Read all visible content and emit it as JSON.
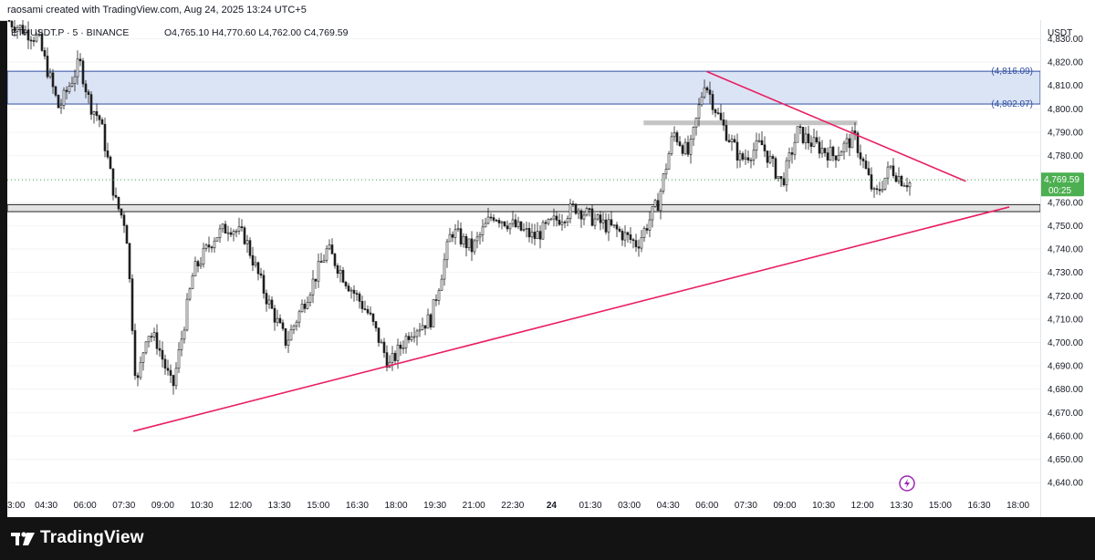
{
  "header": {
    "credit": "raosami created with TradingView.com, Aug 24, 2025 13:24 UTC+5"
  },
  "symbol_info": {
    "symbol": "ETHUSDT.P",
    "interval": "5",
    "exchange": "BINANCE",
    "ohlc": "O4,765.10  H4,770.60  L4,762.00  C4,769.59"
  },
  "price_axis": {
    "currency": "USDT",
    "ticks": [
      "4,830.00",
      "4,820.00",
      "4,810.00",
      "4,800.00",
      "4,790.00",
      "4,780.00",
      "4,770.00",
      "4,760.00",
      "4,750.00",
      "4,740.00",
      "4,730.00",
      "4,720.00",
      "4,710.00",
      "4,700.00",
      "4,690.00",
      "4,680.00",
      "4,670.00",
      "4,660.00",
      "4,650.00",
      "4,640.00"
    ],
    "last_price_label": "4,769.59",
    "countdown": "00:25"
  },
  "time_axis": {
    "ticks": [
      "3:00",
      "04:30",
      "06:00",
      "07:30",
      "09:00",
      "10:30",
      "12:00",
      "13:30",
      "15:00",
      "16:30",
      "18:00",
      "19:30",
      "21:00",
      "22:30",
      "24",
      "01:30",
      "03:00",
      "04:30",
      "06:00",
      "07:30",
      "09:00",
      "10:30",
      "12:00",
      "13:30",
      "15:00",
      "16:30",
      "18:00"
    ]
  },
  "annotations": {
    "zone_top_label": "(4,816.09)",
    "zone_bottom_label": "(4,802.07)"
  },
  "footer": {
    "brand": "TradingView"
  },
  "colors": {
    "up": "#26a69a",
    "down": "#ef5350",
    "candle_body": "#1e1e1e",
    "trendline": "#e91e63",
    "zone_fill": "#dbe4f5",
    "zone_border": "#2f4fa0",
    "support_band": "#e3e3e3",
    "last_price": "#4caf50"
  },
  "chart_data": {
    "type": "candlestick",
    "symbol": "ETHUSDT.P",
    "timeframe": "5",
    "ylim": [
      4635,
      4838
    ],
    "last_price": 4769.59,
    "resistance_zone": [
      4802.07,
      4816.09
    ],
    "support_band": [
      4756,
      4759
    ],
    "mini_resistance_band": [
      4793,
      4795
    ],
    "trendlines": [
      {
        "name": "ascending",
        "points": [
          [
            0.122,
            4662
          ],
          [
            0.97,
            4758
          ]
        ]
      },
      {
        "name": "descending",
        "points": [
          [
            0.677,
            4816
          ],
          [
            0.928,
            4769
          ]
        ]
      }
    ],
    "price_path_hours": [
      [
        0.0,
        4838
      ],
      [
        0.03,
        4830
      ],
      [
        0.05,
        4800
      ],
      [
        0.07,
        4820
      ],
      [
        0.08,
        4802
      ],
      [
        0.09,
        4795
      ],
      [
        0.105,
        4760
      ],
      [
        0.115,
        4750
      ],
      [
        0.125,
        4680
      ],
      [
        0.135,
        4705
      ],
      [
        0.145,
        4700
      ],
      [
        0.16,
        4680
      ],
      [
        0.18,
        4730
      ],
      [
        0.2,
        4745
      ],
      [
        0.215,
        4750
      ],
      [
        0.23,
        4745
      ],
      [
        0.25,
        4720
      ],
      [
        0.27,
        4700
      ],
      [
        0.29,
        4720
      ],
      [
        0.31,
        4740
      ],
      [
        0.33,
        4725
      ],
      [
        0.35,
        4712
      ],
      [
        0.37,
        4690
      ],
      [
        0.39,
        4705
      ],
      [
        0.41,
        4710
      ],
      [
        0.43,
        4748
      ],
      [
        0.45,
        4740
      ],
      [
        0.47,
        4755
      ],
      [
        0.49,
        4750
      ],
      [
        0.51,
        4745
      ],
      [
        0.53,
        4752
      ],
      [
        0.55,
        4758
      ],
      [
        0.57,
        4752
      ],
      [
        0.59,
        4748
      ],
      [
        0.61,
        4742
      ],
      [
        0.63,
        4760
      ],
      [
        0.645,
        4790
      ],
      [
        0.66,
        4780
      ],
      [
        0.675,
        4812
      ],
      [
        0.69,
        4795
      ],
      [
        0.71,
        4778
      ],
      [
        0.73,
        4785
      ],
      [
        0.75,
        4768
      ],
      [
        0.765,
        4790
      ],
      [
        0.78,
        4785
      ],
      [
        0.8,
        4780
      ],
      [
        0.82,
        4788
      ],
      [
        0.84,
        4762
      ],
      [
        0.855,
        4775
      ],
      [
        0.865,
        4770
      ],
      [
        0.875,
        4768
      ]
    ]
  }
}
